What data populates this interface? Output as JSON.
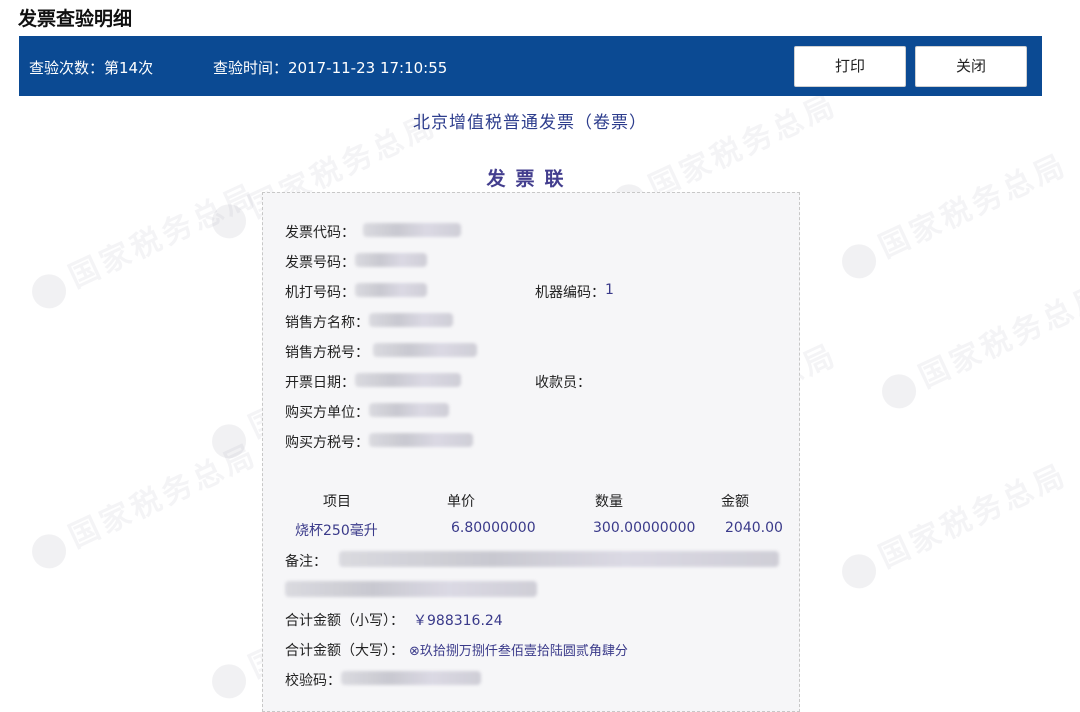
{
  "page": {
    "title": "发票查验明细"
  },
  "header": {
    "check_count": "查验次数：第14次",
    "check_time": "查验时间：2017-11-23 17:10:55",
    "print_label": "打印",
    "close_label": "关闭",
    "bar_color": "#0b4a93"
  },
  "invoice": {
    "type_title": "北京增值税普通发票（卷票）",
    "copy_title": "发票联",
    "fields": {
      "code_label": "发票代码：",
      "number_label": "发票号码：",
      "machine_no_label": "机打号码：",
      "machine_code_label": "机器编码：",
      "machine_code_value": "1",
      "seller_name_label": "销售方名称：",
      "seller_tax_label": "销售方税号：",
      "issue_date_label": "开票日期：",
      "cashier_label": "收款员：",
      "buyer_name_label": "购买方单位：",
      "buyer_tax_label": "购买方税号："
    },
    "items_header": {
      "item": "项目",
      "price": "单价",
      "qty": "数量",
      "amount": "金额"
    },
    "items": [
      {
        "item": "烧杯250毫升",
        "price": "6.80000000",
        "qty": "300.00000000",
        "amount": "2040.00"
      }
    ],
    "remark_label": "备注：",
    "total_small_label": "合计金额（小写）：",
    "total_small_value": "￥988316.24",
    "total_big_label": "合计金额（大写）：",
    "total_big_value": "⊗玖拾捌万捌仟叁佰壹拾陆圆贰角肆分",
    "check_code_label": "校验码："
  },
  "watermark": {
    "text": "国家税务总局"
  }
}
